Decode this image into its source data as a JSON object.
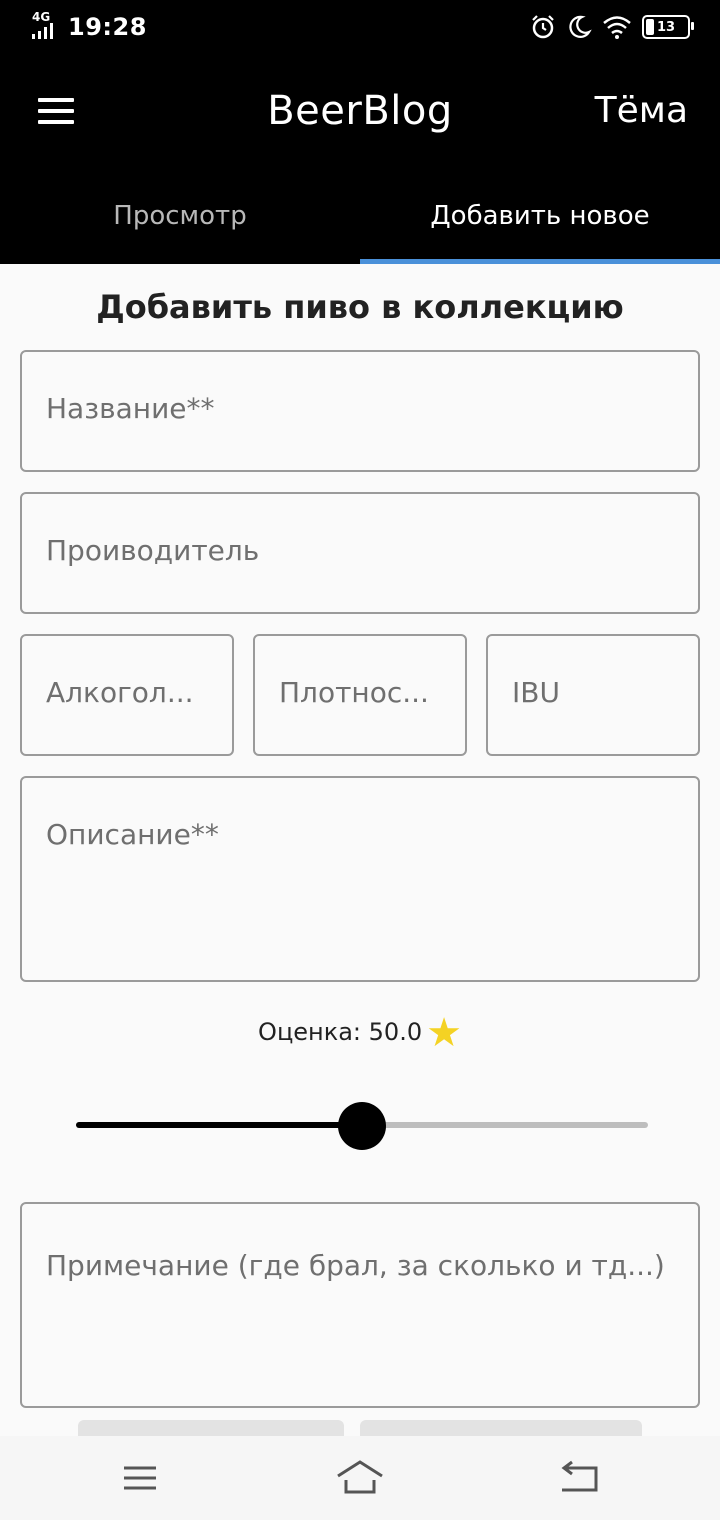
{
  "status_bar": {
    "network": "4G",
    "time": "19:28",
    "battery": "13",
    "icons": [
      "signal-icon",
      "alarm-icon",
      "moon-icon",
      "wifi-icon",
      "battery-icon"
    ]
  },
  "app_bar": {
    "title": "BeerBlog",
    "theme_label": "Тёма",
    "menu_icon": "hamburger-menu-icon"
  },
  "tabs": [
    {
      "label": "Просмотр",
      "active": false
    },
    {
      "label": "Добавить новое",
      "active": true
    }
  ],
  "form": {
    "title": "Добавить пиво в коллекцию",
    "name_placeholder": "Название**",
    "producer_placeholder": "Проиводитель",
    "alcohol_placeholder": "Алкогол...",
    "density_placeholder": "Плотнос...",
    "ibu_placeholder": "IBU",
    "description_placeholder": "Описание**",
    "rating_label": "Оценка: 50.0",
    "rating_value": 50.0,
    "rating_fraction": 0.5,
    "note_placeholder": "Примечание (где брал, за сколько и тд...)"
  },
  "colors": {
    "app_bar": "#000000",
    "tab_indicator": "#4a90d9",
    "star": "#f4d224"
  },
  "nav_bar": {
    "icons": [
      "recent-apps-icon",
      "home-icon",
      "back-icon"
    ]
  }
}
